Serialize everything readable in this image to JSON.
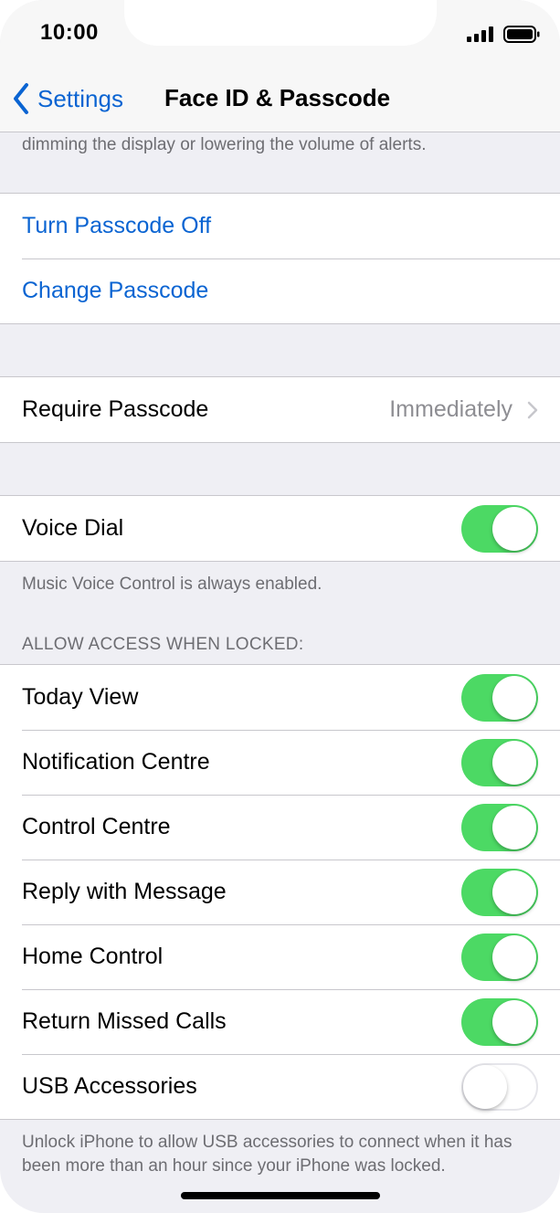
{
  "status_bar": {
    "time": "10:00"
  },
  "nav": {
    "back_label": "Settings",
    "title": "Face ID & Passcode"
  },
  "top_note": "dimming the display or lowering the volume of alerts.",
  "passcode_actions": [
    {
      "label": "Turn Passcode Off"
    },
    {
      "label": "Change Passcode"
    }
  ],
  "require_passcode": {
    "label": "Require Passcode",
    "value": "Immediately"
  },
  "voice_dial": {
    "label": "Voice Dial",
    "on": true,
    "footer": "Music Voice Control is always enabled."
  },
  "locked_access": {
    "header": "ALLOW ACCESS WHEN LOCKED:",
    "items": [
      {
        "label": "Today View",
        "on": true
      },
      {
        "label": "Notification Centre",
        "on": true
      },
      {
        "label": "Control Centre",
        "on": true
      },
      {
        "label": "Reply with Message",
        "on": true
      },
      {
        "label": "Home Control",
        "on": true
      },
      {
        "label": "Return Missed Calls",
        "on": true
      },
      {
        "label": "USB Accessories",
        "on": false
      }
    ],
    "footer": "Unlock iPhone to allow USB accessories to connect when it has been more than an hour since your iPhone was locked."
  },
  "colors": {
    "accent": "#0a64d2",
    "toggle_on": "#4cd964",
    "background": "#efeff4"
  }
}
